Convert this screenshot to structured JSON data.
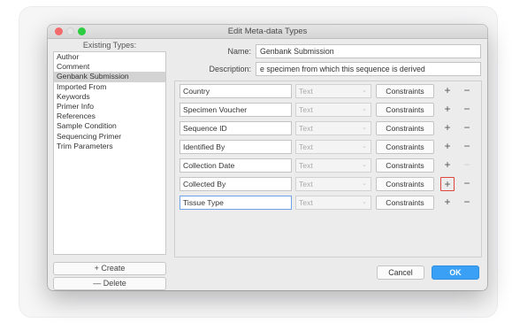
{
  "window": {
    "title": "Edit Meta-data Types"
  },
  "sidebar": {
    "heading": "Existing Types:",
    "items": [
      {
        "label": "Author"
      },
      {
        "label": "Comment"
      },
      {
        "label": "Genbank Submission",
        "selected": true
      },
      {
        "label": "Imported From"
      },
      {
        "label": "Keywords"
      },
      {
        "label": "Primer Info"
      },
      {
        "label": "References"
      },
      {
        "label": "Sample Condition"
      },
      {
        "label": "Sequencing Primer"
      },
      {
        "label": "Trim Parameters"
      }
    ],
    "create_label": "+ Create",
    "delete_label": "— Delete"
  },
  "form": {
    "name_label": "Name:",
    "name_value": "Genbank Submission",
    "description_label": "Description:",
    "description_value": "e specimen from which this sequence is derived"
  },
  "fields": [
    {
      "name": "Country",
      "type": "Text",
      "constraints": "Constraints"
    },
    {
      "name": "Specimen Voucher",
      "type": "Text",
      "constraints": "Constraints"
    },
    {
      "name": "Sequence ID",
      "type": "Text",
      "constraints": "Constraints"
    },
    {
      "name": "Identified By",
      "type": "Text",
      "constraints": "Constraints"
    },
    {
      "name": "Collection Date",
      "type": "Text",
      "constraints": "Constraints"
    },
    {
      "name": "Collected By",
      "type": "Text",
      "constraints": "Constraints"
    },
    {
      "name": "Tissue Type",
      "type": "Text",
      "constraints": "Constraints"
    }
  ],
  "footer": {
    "cancel_label": "Cancel",
    "ok_label": "OK"
  },
  "colors": {
    "accent": "#3aa0f5",
    "highlight": "#e0463c"
  }
}
